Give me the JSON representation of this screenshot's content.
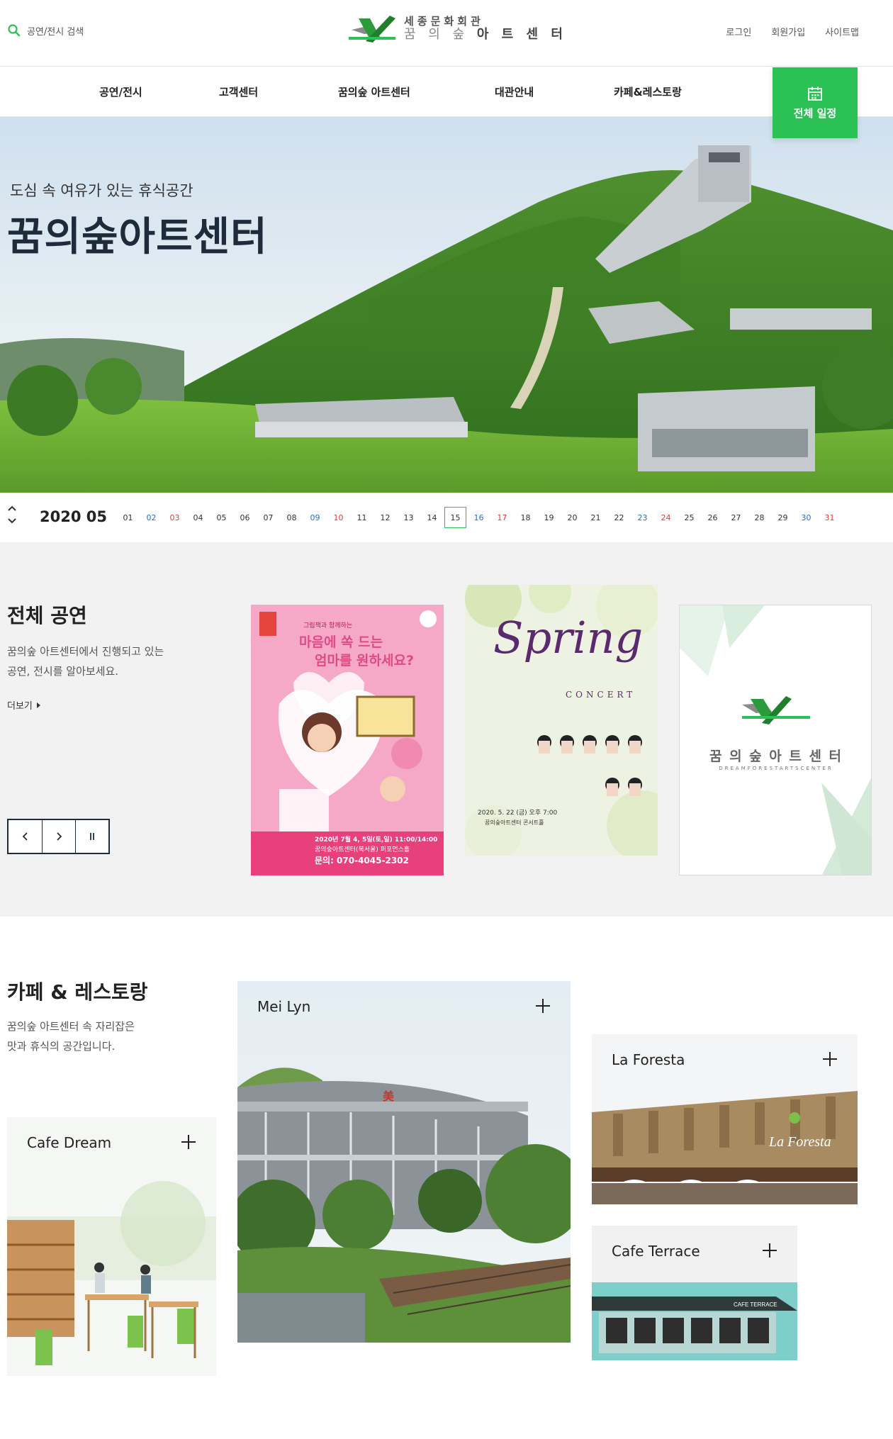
{
  "header": {
    "search_text": "공연/전시 검색",
    "logo_top": "세종문화회관",
    "logo_bottom_light": "꿈 의 숲 ",
    "logo_bottom_bold": "아 트 센 터",
    "util": [
      "로그인",
      "회원가입",
      "사이트맵"
    ]
  },
  "nav": {
    "items": [
      "공연/전시",
      "고객센터",
      "꿈의숲 아트센터",
      "대관안내",
      "카페&레스토랑"
    ],
    "schedule_button": "전체 일정"
  },
  "hero": {
    "subtitle": "도심 속 여유가 있는 휴식공간",
    "title": "꿈의숲아트센터"
  },
  "calendar": {
    "year_month": "2020 05",
    "selected_day": "15",
    "days": [
      {
        "d": "01",
        "t": "w"
      },
      {
        "d": "02",
        "t": "sat"
      },
      {
        "d": "03",
        "t": "sun"
      },
      {
        "d": "04",
        "t": "w"
      },
      {
        "d": "05",
        "t": "w"
      },
      {
        "d": "06",
        "t": "w"
      },
      {
        "d": "07",
        "t": "w"
      },
      {
        "d": "08",
        "t": "w"
      },
      {
        "d": "09",
        "t": "sat"
      },
      {
        "d": "10",
        "t": "sun"
      },
      {
        "d": "11",
        "t": "w"
      },
      {
        "d": "12",
        "t": "w"
      },
      {
        "d": "13",
        "t": "w"
      },
      {
        "d": "14",
        "t": "w"
      },
      {
        "d": "15",
        "t": "w"
      },
      {
        "d": "16",
        "t": "sat"
      },
      {
        "d": "17",
        "t": "sun"
      },
      {
        "d": "18",
        "t": "w"
      },
      {
        "d": "19",
        "t": "w"
      },
      {
        "d": "20",
        "t": "w"
      },
      {
        "d": "21",
        "t": "w"
      },
      {
        "d": "22",
        "t": "w"
      },
      {
        "d": "23",
        "t": "sat"
      },
      {
        "d": "24",
        "t": "sun"
      },
      {
        "d": "25",
        "t": "w"
      },
      {
        "d": "26",
        "t": "w"
      },
      {
        "d": "27",
        "t": "w"
      },
      {
        "d": "28",
        "t": "w"
      },
      {
        "d": "29",
        "t": "w"
      },
      {
        "d": "30",
        "t": "sat"
      },
      {
        "d": "31",
        "t": "sun"
      }
    ]
  },
  "performances": {
    "title": "전체 공연",
    "desc_line1": "꿈의숲 아트센터에서 진행되고 있는",
    "desc_line2": "공연, 전시를 알아보세요.",
    "more": "더보기",
    "posters": [
      {
        "small_title": "그림책과 함께하는",
        "line1": "마음에 쏙 드는",
        "line2": "엄마를 원하세요?",
        "date": "2020년 7월 4, 5일(토,일) 11:00/14:00",
        "venue": "꿈의숲아트센터(북서울) 퍼포먼스홀",
        "phone": "문의: 070-4045-2302"
      },
      {
        "script": "Spring",
        "sub": "CONCERT",
        "date": "2020. 5. 22 (금) 오후 7:00",
        "venue": "꿈의숲아트센터 콘서트홀"
      },
      {
        "brand": "꿈 의 숲 아 트 센 터",
        "brand_en": "DREAMFORESTARTSCENTER"
      }
    ]
  },
  "cafe": {
    "title": "카페 & 레스토랑",
    "desc_line1": "꿈의숲 아트센터 속 자리잡은",
    "desc_line2": "맛과 휴식의 공간입니다.",
    "cards": [
      "Cafe Dream",
      "Mei Lyn",
      "La Foresta",
      "Cafe Terrace"
    ],
    "signs": {
      "la_foresta": "La Foresta",
      "cafe_terrace": "CAFE TERRACE"
    }
  },
  "colors": {
    "accent": "#2bc155",
    "saturday": "#1f6fd1",
    "sunday": "#e03a3a",
    "navy": "#1e2b3a"
  }
}
